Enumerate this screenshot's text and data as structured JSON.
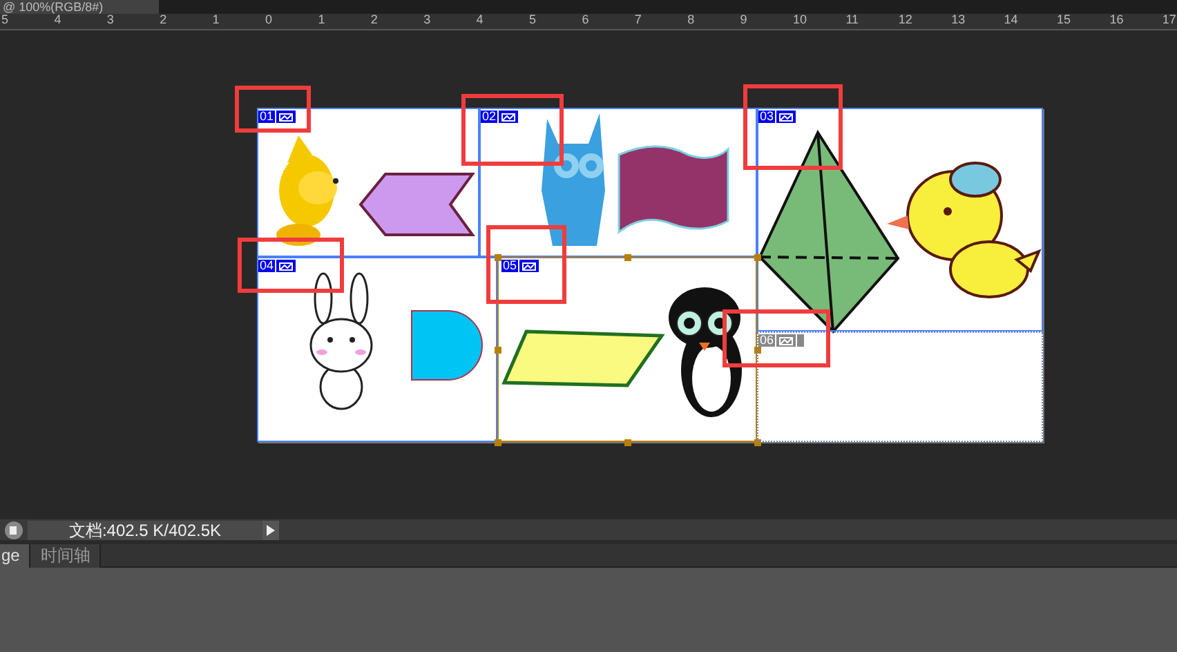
{
  "document_tab": {
    "title": "@ 100%(RGB/8#)"
  },
  "ruler": [
    "5",
    "4",
    "3",
    "2",
    "1",
    "0",
    "1",
    "2",
    "3",
    "4",
    "5",
    "6",
    "7",
    "8",
    "9",
    "10",
    "11",
    "12",
    "13",
    "14",
    "15",
    "16",
    "17"
  ],
  "slices": [
    {
      "number": "01",
      "kind": "user",
      "selected": false,
      "highlighted": true
    },
    {
      "number": "02",
      "kind": "user",
      "selected": false,
      "highlighted": true
    },
    {
      "number": "03",
      "kind": "user",
      "selected": false,
      "highlighted": true
    },
    {
      "number": "04",
      "kind": "user",
      "selected": false,
      "highlighted": true
    },
    {
      "number": "05",
      "kind": "user",
      "selected": true,
      "highlighted": true
    },
    {
      "number": "06",
      "kind": "auto",
      "selected": false,
      "highlighted": true
    }
  ],
  "status_bar": {
    "text": "文档:402.5 K/402.5K"
  },
  "panel_tabs": [
    {
      "label": "ge",
      "selected": true
    },
    {
      "label": "时间轴",
      "selected": false
    }
  ]
}
